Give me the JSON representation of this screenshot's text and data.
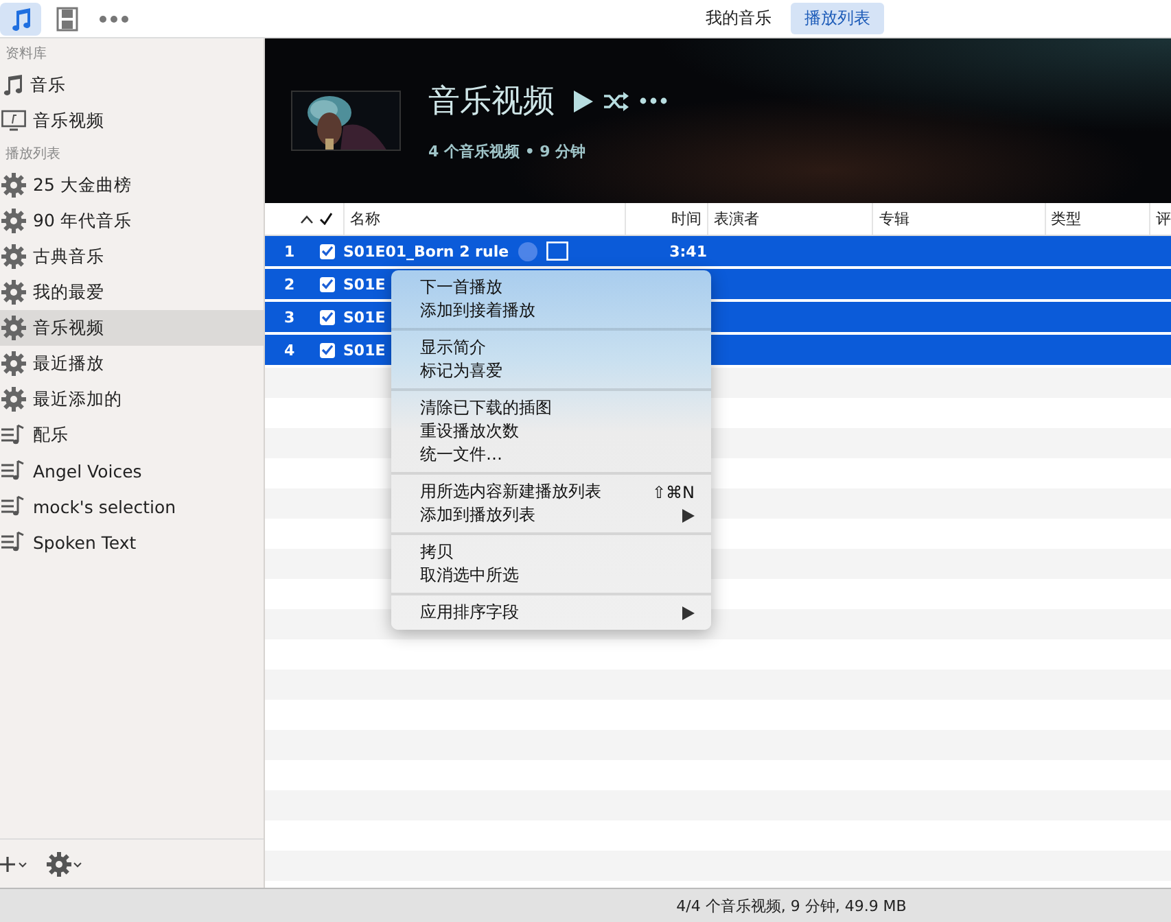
{
  "toolbar": {
    "views": [
      {
        "kind": "music",
        "selected": true
      },
      {
        "kind": "film",
        "selected": false
      },
      {
        "kind": "more",
        "selected": false
      }
    ],
    "tabs": [
      {
        "label": "我的音乐",
        "selected": false
      },
      {
        "label": "播放列表",
        "selected": true
      }
    ]
  },
  "sidebar": {
    "sections": [
      {
        "title": "资料库",
        "items": [
          {
            "label": "音乐",
            "kind": "note",
            "selected": false
          },
          {
            "label": "音乐视频",
            "kind": "screen",
            "selected": false
          }
        ]
      },
      {
        "title": "播放列表",
        "items": [
          {
            "label": "25 大金曲榜",
            "kind": "smart",
            "selected": false
          },
          {
            "label": "90 年代音乐",
            "kind": "smart",
            "selected": false
          },
          {
            "label": "古典音乐",
            "kind": "smart",
            "selected": false
          },
          {
            "label": "我的最爱",
            "kind": "smart",
            "selected": false
          },
          {
            "label": "音乐视频",
            "kind": "smart",
            "selected": true
          },
          {
            "label": "最近播放",
            "kind": "smart",
            "selected": false
          },
          {
            "label": "最近添加的",
            "kind": "smart",
            "selected": false
          },
          {
            "label": "配乐",
            "kind": "list",
            "selected": false
          },
          {
            "label": "Angel Voices",
            "kind": "list",
            "selected": false
          },
          {
            "label": "mock's selection",
            "kind": "list",
            "selected": false
          },
          {
            "label": "Spoken Text",
            "kind": "list",
            "selected": false
          }
        ]
      }
    ]
  },
  "header": {
    "title": "音乐视频",
    "subtitle": "4 个音乐视频 • 9 分钟"
  },
  "table": {
    "columns": [
      "名称",
      "时间",
      "表演者",
      "专辑",
      "类型",
      "评"
    ],
    "rows": [
      {
        "number": "1",
        "checked": true,
        "name": "S01E01_Born 2 rule",
        "time": "3:41",
        "selected": true
      },
      {
        "number": "2",
        "checked": true,
        "name": "S01E",
        "selected": true
      },
      {
        "number": "3",
        "checked": true,
        "name": "S01E",
        "selected": true
      },
      {
        "number": "4",
        "checked": true,
        "name": "S01E",
        "selected": true
      }
    ]
  },
  "context_menu": {
    "groups": [
      [
        {
          "label": "下一首播放"
        },
        {
          "label": "添加到接着播放"
        }
      ],
      [
        {
          "label": "显示简介"
        },
        {
          "label": "标记为喜爱"
        }
      ],
      [
        {
          "label": "清除已下载的插图"
        },
        {
          "label": "重设播放次数"
        },
        {
          "label": "统一文件…"
        }
      ],
      [
        {
          "label": "用所选内容新建播放列表",
          "shortcut": "⇧⌘N"
        },
        {
          "label": "添加到播放列表",
          "submenu": true
        }
      ],
      [
        {
          "label": "拷贝"
        },
        {
          "label": "取消选中所选"
        }
      ],
      [
        {
          "label": "应用排序字段",
          "submenu": true
        }
      ]
    ]
  },
  "status_bar": "4/4 个音乐视频, 9 分钟, 49.9 MB"
}
